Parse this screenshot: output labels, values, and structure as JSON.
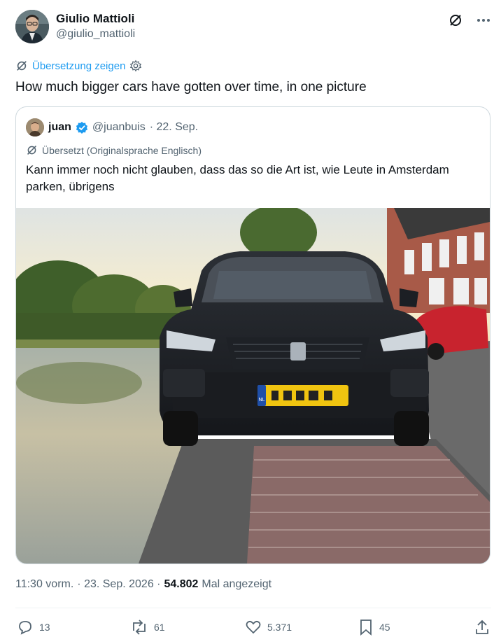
{
  "author": {
    "display_name": "Giulio Mattioli",
    "handle": "@giulio_mattioli"
  },
  "translate": {
    "label": "Übersetzung zeigen"
  },
  "tweet": {
    "text": "How much bigger cars have gotten over time, in one picture"
  },
  "quote": {
    "name": "juan",
    "handle": "@juanbuis",
    "date": "· 22. Sep.",
    "translated_note": "Übersetzt (Originalsprache Englisch)",
    "text": "Kann immer noch nicht glauben, dass das so die Art ist, wie Leute in Amsterdam parken, übrigens",
    "plate_country": "NL"
  },
  "meta": {
    "time": "11:30 vorm.",
    "date": "· 23. Sep. 2026 ·",
    "views": "54.802",
    "views_label": "Mal angezeigt"
  },
  "actions": {
    "replies": "13",
    "reposts": "61",
    "likes": "5.371",
    "bookmarks": "45"
  },
  "colors": {
    "accent": "#1d9bf0",
    "secondary_text": "#536471",
    "border": "#cfd9de"
  }
}
